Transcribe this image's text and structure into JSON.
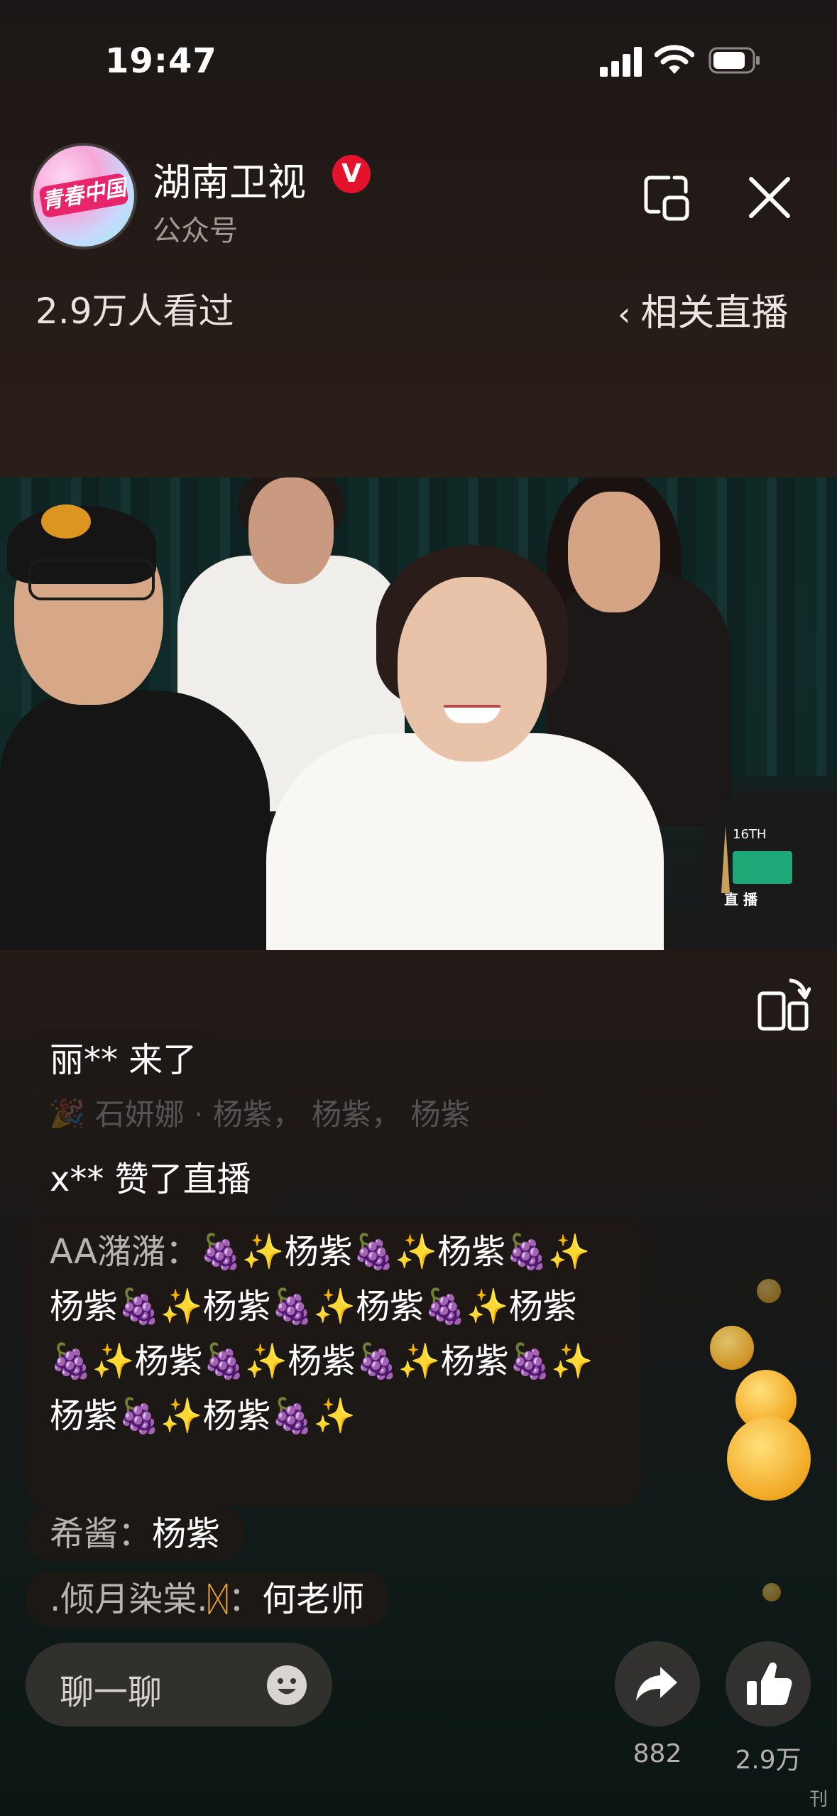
{
  "status_bar": {
    "time": "19:47"
  },
  "header": {
    "avatar_text": "青春中国",
    "channel_name": "湖南卫视",
    "verified_badge": "V",
    "subtitle": "公众号",
    "viewers": "2.9万人看过",
    "related_live": "相关直播"
  },
  "video": {
    "live_label": "直 播",
    "award_badge": "16TH"
  },
  "comments": [
    {
      "text": "丽** 来了"
    },
    {
      "text": "🎉 石妍娜 · 杨紫，  杨紫，  杨紫"
    },
    {
      "text": "x** 赞了直播"
    },
    {
      "user": "AA潴潴",
      "text": "🍇✨杨紫🍇✨杨紫🍇✨杨紫🍇✨杨紫🍇✨杨紫🍇✨杨紫🍇✨杨紫🍇✨杨紫🍇✨杨紫🍇✨杨紫🍇✨杨紫🍇✨"
    },
    {
      "user": "希酱",
      "text": "杨紫"
    },
    {
      "user": ".倾月染棠.",
      "badge": "ᛞ",
      "text": "何老师"
    }
  ],
  "bottom_bar": {
    "chat_placeholder": "聊一聊",
    "share_count": "882",
    "like_count": "2.9万"
  },
  "corner_mark": "刊",
  "colors": {
    "verified": "#e4122b",
    "username": "#b9b4b1",
    "badge": "#f0a431"
  }
}
